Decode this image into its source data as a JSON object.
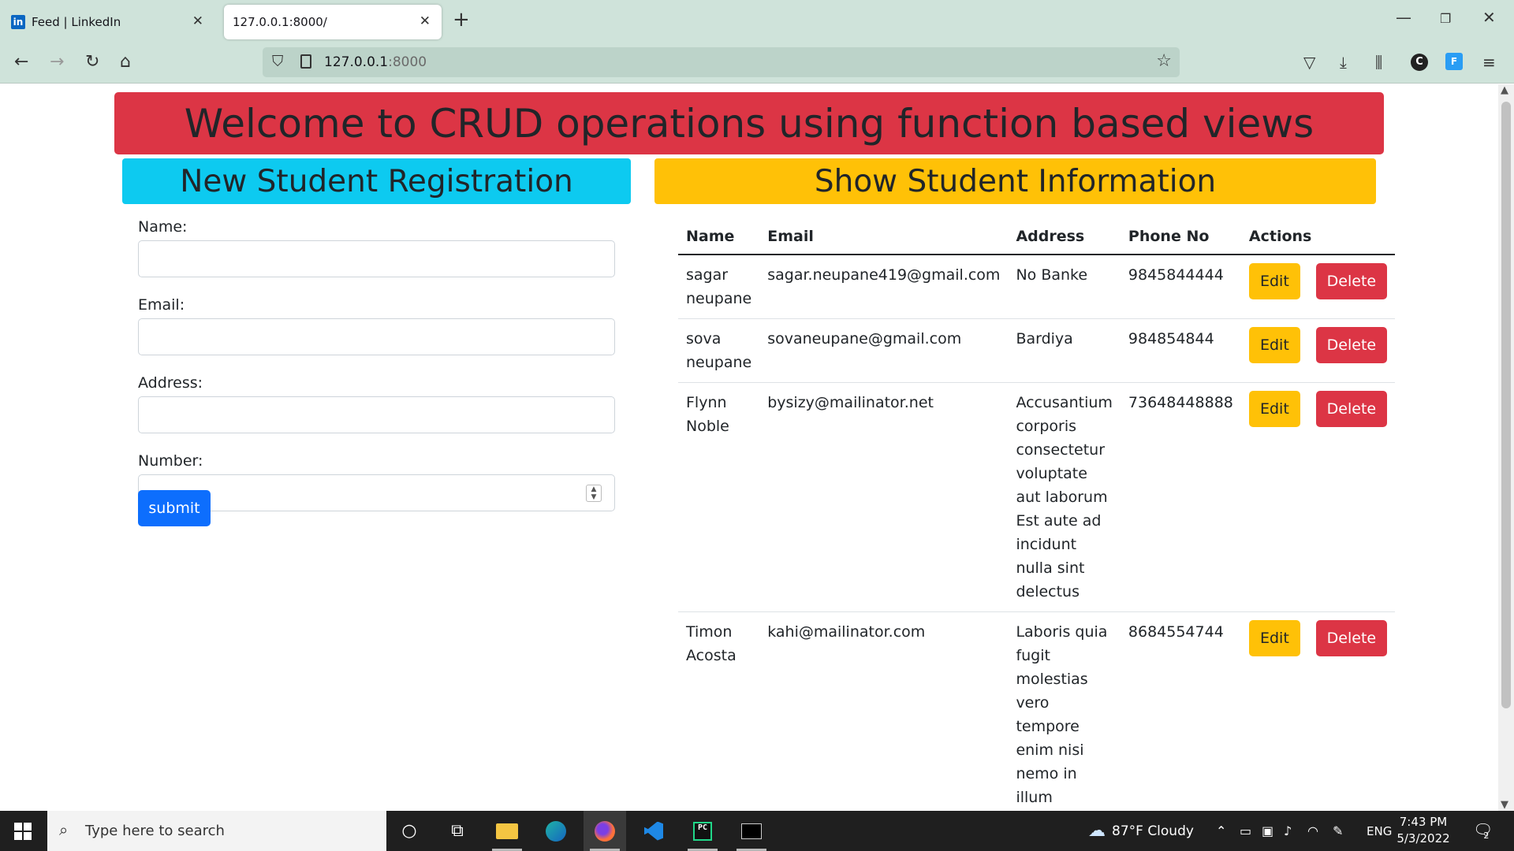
{
  "browser": {
    "tabs": [
      {
        "title": "Feed | LinkedIn",
        "icon": "linkedin-icon"
      },
      {
        "title": "127.0.0.1:8000/",
        "icon": ""
      }
    ],
    "url_host": "127.0.0.1",
    "url_port": ":8000"
  },
  "page": {
    "banner": "Welcome to CRUD operations using function based views",
    "registration_title": "New Student Registration",
    "info_title": "Show Student Information",
    "form": {
      "name_label": "Name:",
      "email_label": "Email:",
      "address_label": "Address:",
      "number_label": "Number:",
      "submit_label": "submit"
    },
    "table": {
      "headers": [
        "Name",
        "Email",
        "Address",
        "Phone No",
        "Actions"
      ],
      "edit_label": "Edit",
      "delete_label": "Delete",
      "rows": [
        {
          "name": "sagar neupane",
          "email": "sagar.neupane419@gmail.com",
          "address": "No Banke",
          "phone": "9845844444"
        },
        {
          "name": "sova neupane",
          "email": "sovaneupane@gmail.com",
          "address": "Bardiya",
          "phone": "984854844"
        },
        {
          "name": "Flynn Noble",
          "email": "bysizy@mailinator.net",
          "address": "Accusantium corporis consectetur voluptate aut laborum Est aute ad incidunt nulla sint delectus",
          "phone": "73648448888"
        },
        {
          "name": "Timon Acosta",
          "email": "kahi@mailinator.com",
          "address": "Laboris quia fugit molestias vero tempore enim nisi nemo in illum",
          "phone": "8684554744"
        }
      ]
    }
  },
  "taskbar": {
    "search_placeholder": "Type here to search",
    "weather": "87°F  Cloudy",
    "language": "ENG",
    "time": "7:43 PM",
    "date": "5/3/2022",
    "notifications": "2"
  },
  "colors": {
    "banner": "#dc3545",
    "registration_header": "#0dcaf0",
    "info_header": "#ffc107",
    "submit": "#0d6efd",
    "edit": "#ffc107",
    "delete": "#dc3545"
  }
}
